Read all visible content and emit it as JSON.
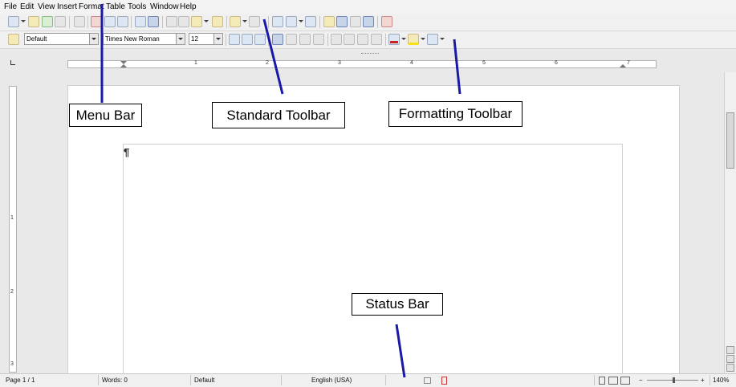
{
  "menu": [
    "File",
    "Edit",
    "View",
    "Insert",
    "Format",
    "Table",
    "Tools",
    "Window",
    "Help"
  ],
  "formatting": {
    "paragraph_style": "Default",
    "font_name": "Times New Roman",
    "font_size": "12"
  },
  "document": {
    "pilcrow": "¶"
  },
  "rulers": {
    "horizontal_numbers": [
      "1",
      "2",
      "3",
      "4",
      "5",
      "6",
      "7"
    ],
    "vertical_numbers": [
      "1",
      "2",
      "3"
    ]
  },
  "status": {
    "page": "Page 1 / 1",
    "words": "Words: 0",
    "page_style": "Default",
    "language": "English (USA)",
    "zoom": "140%"
  },
  "callouts": {
    "menu_bar": "Menu Bar",
    "standard_toolbar": "Standard Toolbar",
    "formatting_toolbar": "Formatting Toolbar",
    "status_bar": "Status Bar"
  },
  "colors": {
    "leader_line": "#1a1aa6",
    "font_color_swatch": "#cc2222",
    "highlight_swatch": "#f7e018"
  }
}
